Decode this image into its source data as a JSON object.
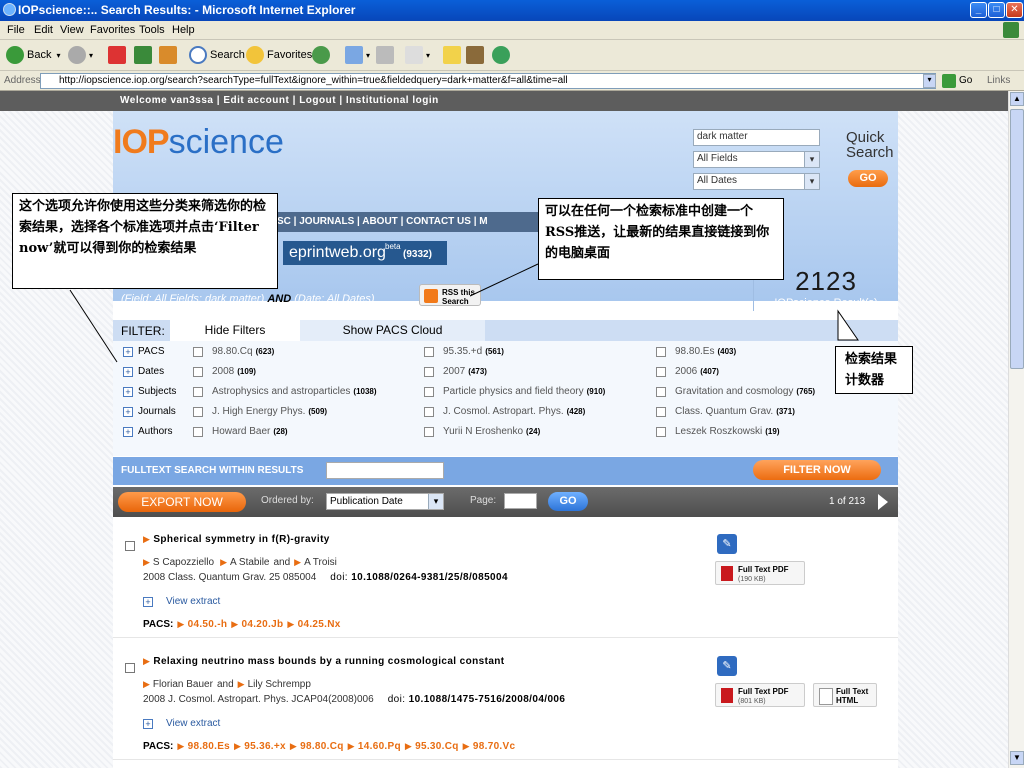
{
  "window": {
    "title": "IOPscience::.. Search Results: - Microsoft Internet Explorer"
  },
  "menu": [
    "File",
    "Edit",
    "View",
    "Favorites",
    "Tools",
    "Help"
  ],
  "toolbar": {
    "back": "Back",
    "search": "Search",
    "favorites": "Favorites"
  },
  "address": {
    "label": "Address",
    "url": "http://iopscience.iop.org/search?searchType=fullText&ignore_within=true&fieldedquery=dark+matter&f=all&time=all",
    "go": "Go",
    "links": "Links"
  },
  "topnav": {
    "text": "Welcome van3ssa | Edit account  |  Logout  |  Institutional login"
  },
  "logo": {
    "iop": "IOP",
    "science": "science"
  },
  "quicksearch": {
    "query": "dark matter",
    "field": "All Fields",
    "dates": "All Dates",
    "label": "Quick Search",
    "go": "GO"
  },
  "nav": {
    "items": "SC  |  JOURNALS  |  ABOUT  |  CONTACT US  |  M"
  },
  "eprint": {
    "name": "eprintweb.org",
    "sup": "beta",
    "count": "(9332)"
  },
  "results_header": {
    "field_line": "(Field: All Fields: dark matter)",
    "and": "AND",
    "date_line": "(Date: All Dates)",
    "rss": "RSS this Search",
    "count": "2123",
    "count_label": "IOPscience Result(s)"
  },
  "filter": {
    "label": "FILTER:",
    "tab_hide": "Hide Filters",
    "tab_pacs": "Show PACS Cloud",
    "rows": [
      {
        "cat": "PACS",
        "opts": [
          {
            "t": "98.80.Cq",
            "n": "(623)"
          },
          {
            "t": "95.35.+d",
            "n": "(561)"
          },
          {
            "t": "98.80.Es",
            "n": "(403)"
          }
        ]
      },
      {
        "cat": "Dates",
        "opts": [
          {
            "t": "2008",
            "n": "(109)"
          },
          {
            "t": "2007",
            "n": "(473)"
          },
          {
            "t": "2006",
            "n": "(407)"
          }
        ]
      },
      {
        "cat": "Subjects",
        "opts": [
          {
            "t": "Astrophysics and astroparticles",
            "n": "(1038)"
          },
          {
            "t": "Particle physics and field theory",
            "n": "(910)"
          },
          {
            "t": "Gravitation and cosmology",
            "n": "(765)"
          }
        ]
      },
      {
        "cat": "Journals",
        "opts": [
          {
            "t": "J. High Energy Phys.",
            "n": "(509)"
          },
          {
            "t": "J. Cosmol. Astropart. Phys.",
            "n": "(428)"
          },
          {
            "t": "Class. Quantum Grav.",
            "n": "(371)"
          }
        ]
      },
      {
        "cat": "Authors",
        "opts": [
          {
            "t": "Howard Baer",
            "n": "(28)"
          },
          {
            "t": "Yurii N Eroshenko",
            "n": "(24)"
          },
          {
            "t": "Leszek Roszkowski",
            "n": "(19)"
          }
        ]
      }
    ],
    "fulltext_label": "FULLTEXT SEARCH WITHIN RESULTS",
    "filter_now": "FILTER NOW"
  },
  "exportbar": {
    "export": "EXPORT NOW",
    "ordered_by": "Ordered by:",
    "order_value": "Publication Date",
    "page_label": "Page:",
    "go": "GO",
    "page_info": "1 of 213"
  },
  "results": [
    {
      "title": "Spherical symmetry in f(R)-gravity",
      "authors": [
        "S Capozziello",
        "A Stabile",
        "A Troisi"
      ],
      "and": "and",
      "ref": "2008 Class. Quantum Grav. 25 085004",
      "doi_label": "doi:",
      "doi": "10.1088/0264-9381/25/8/085004",
      "extract": "View extract",
      "pacs_label": "PACS:",
      "pacs": [
        "04.50.-h",
        "04.20.Jb",
        "04.25.Nx"
      ],
      "pdf": "Full Text PDF",
      "pdf_size": "(190 KB)"
    },
    {
      "title": "Relaxing neutrino mass bounds by a running cosmological constant",
      "authors": [
        "Florian Bauer",
        "Lily Schrempp"
      ],
      "and": "and",
      "ref": "2008 J. Cosmol. Astropart. Phys. JCAP04(2008)006",
      "doi_label": "doi:",
      "doi": "10.1088/1475-7516/2008/04/006",
      "extract": "View extract",
      "pacs_label": "PACS:",
      "pacs": [
        "98.80.Es",
        "95.36.+x",
        "98.80.Cq",
        "14.60.Pq",
        "95.30.Cq",
        "98.70.Vc"
      ],
      "pdf": "Full Text PDF",
      "pdf_size": "(801 KB)",
      "html": "Full Text HTML"
    }
  ],
  "callouts": {
    "filter_note": "这个选项允许你使用这些分类来筛选你的检索结果，选择各个标准选项并点击‘Filter now’就可以得到你的检索结果",
    "rss_note": "可以在任何一个检索标准中创建一个RSS推送，让最新的结果直接链接到你的电脑桌面",
    "counter_note": "检索结果计数器"
  }
}
